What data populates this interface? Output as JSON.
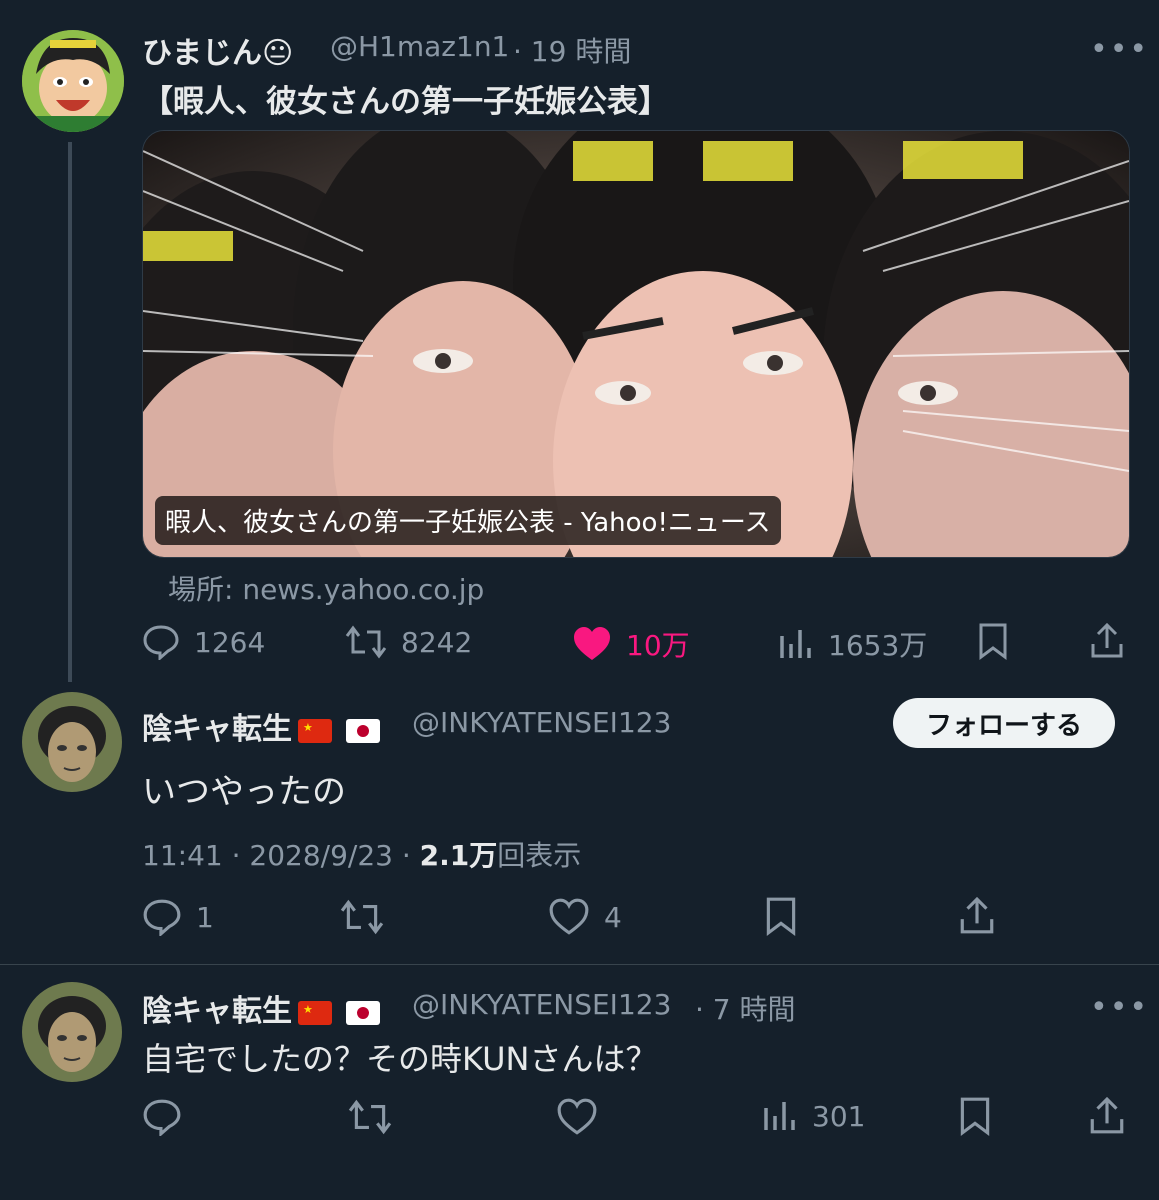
{
  "tweet1": {
    "name": "ひまじん😐",
    "handle": "@H1maz1n1",
    "time": "· 19 時間",
    "more": "•••",
    "text": "【暇人、彼女さんの第一子妊娠公表】",
    "card": {
      "caption": "暇人、彼女さんの第一子妊娠公表 - Yahoo!ニュース",
      "source": "場所: news.yahoo.co.jp"
    },
    "actions": {
      "replies": "1264",
      "retweets": "8242",
      "likes": "10万",
      "views": "1653万"
    }
  },
  "reply1": {
    "name": "陰キャ転生",
    "handle": "@INKYATENSEI123",
    "follow_label": "フォローする",
    "text": "いつやったの",
    "timestamp": "11:41 · 2028/9/23 · ",
    "views_count": "2.1万",
    "views_label": "回表示",
    "actions": {
      "replies": "1",
      "likes": "4"
    }
  },
  "reply2": {
    "name": "陰キャ転生",
    "handle": "@INKYATENSEI123",
    "time": "· 7 時間",
    "more": "•••",
    "text": "自宅でしたの？その時KUNさんは？",
    "actions": {
      "views": "301"
    }
  },
  "colors": {
    "background": "#15202b",
    "like_active": "#f91880",
    "muted": "#8b98a5"
  }
}
